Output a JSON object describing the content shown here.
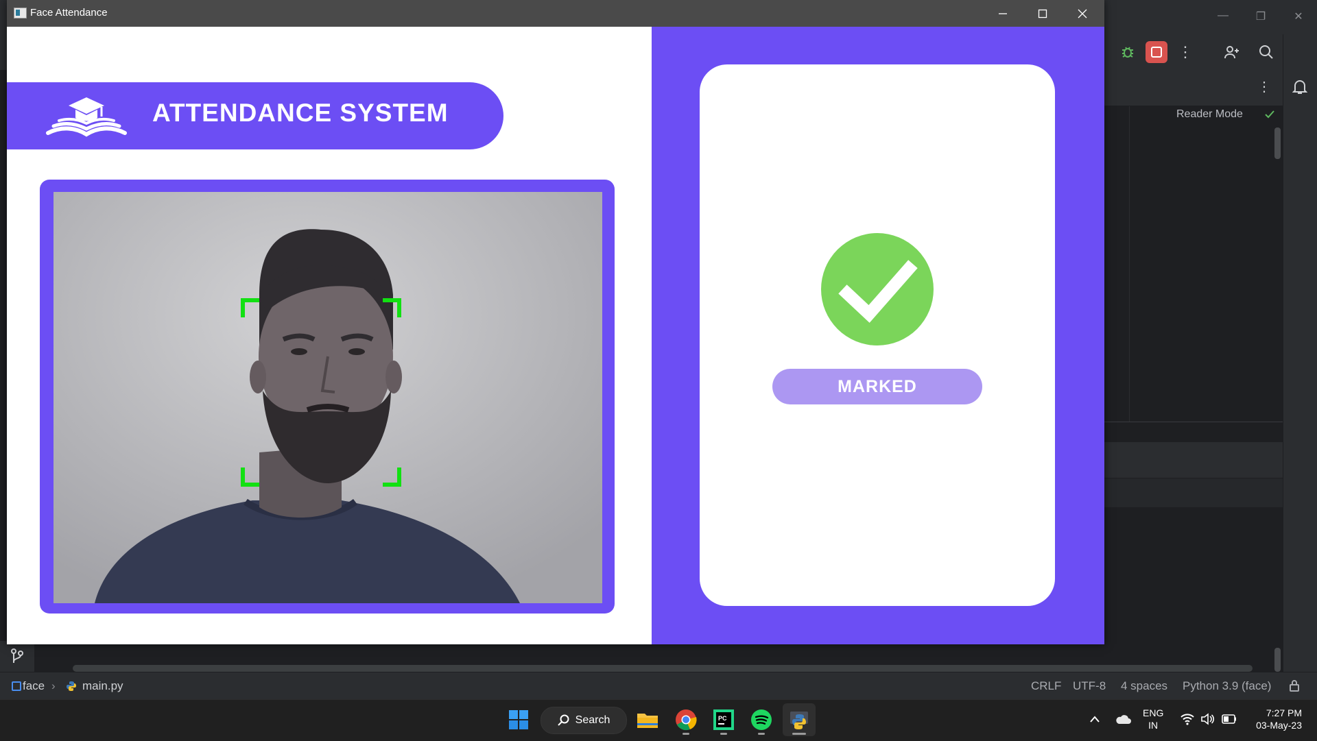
{
  "window": {
    "title": "Face Attendance",
    "controls": [
      "minimize-icon",
      "maximize-icon",
      "close-icon"
    ]
  },
  "banner": {
    "title": "ATTENDANCE SYSTEM",
    "logo": "graduation-book-icon"
  },
  "camera": {
    "detection": "face-bounding-corners",
    "corner_color": "#12e012"
  },
  "status_card": {
    "icon": "check-circle-icon",
    "label": "MARKED"
  },
  "ide": {
    "reader_mode": "Reader Mode",
    "breadcrumb": {
      "project": "face",
      "file": "main.py"
    },
    "status": {
      "line_ending": "CRLF",
      "encoding": "UTF-8",
      "indent": "4 spaces",
      "interpreter": "Python 3.9 (face)"
    }
  },
  "taskbar": {
    "search_label": "Search",
    "apps": [
      "windows-start-icon",
      "file-explorer-icon",
      "chrome-icon",
      "pycharm-icon",
      "spotify-icon",
      "python-icon"
    ],
    "language": {
      "line1": "ENG",
      "line2": "IN"
    },
    "clock": {
      "time": "7:27 PM",
      "date": "03-May-23"
    }
  },
  "colors": {
    "accent_purple": "#6c4ef4",
    "pill_purple": "#ac97f2",
    "success_green": "#7bd55a",
    "detect_green": "#12e012"
  }
}
